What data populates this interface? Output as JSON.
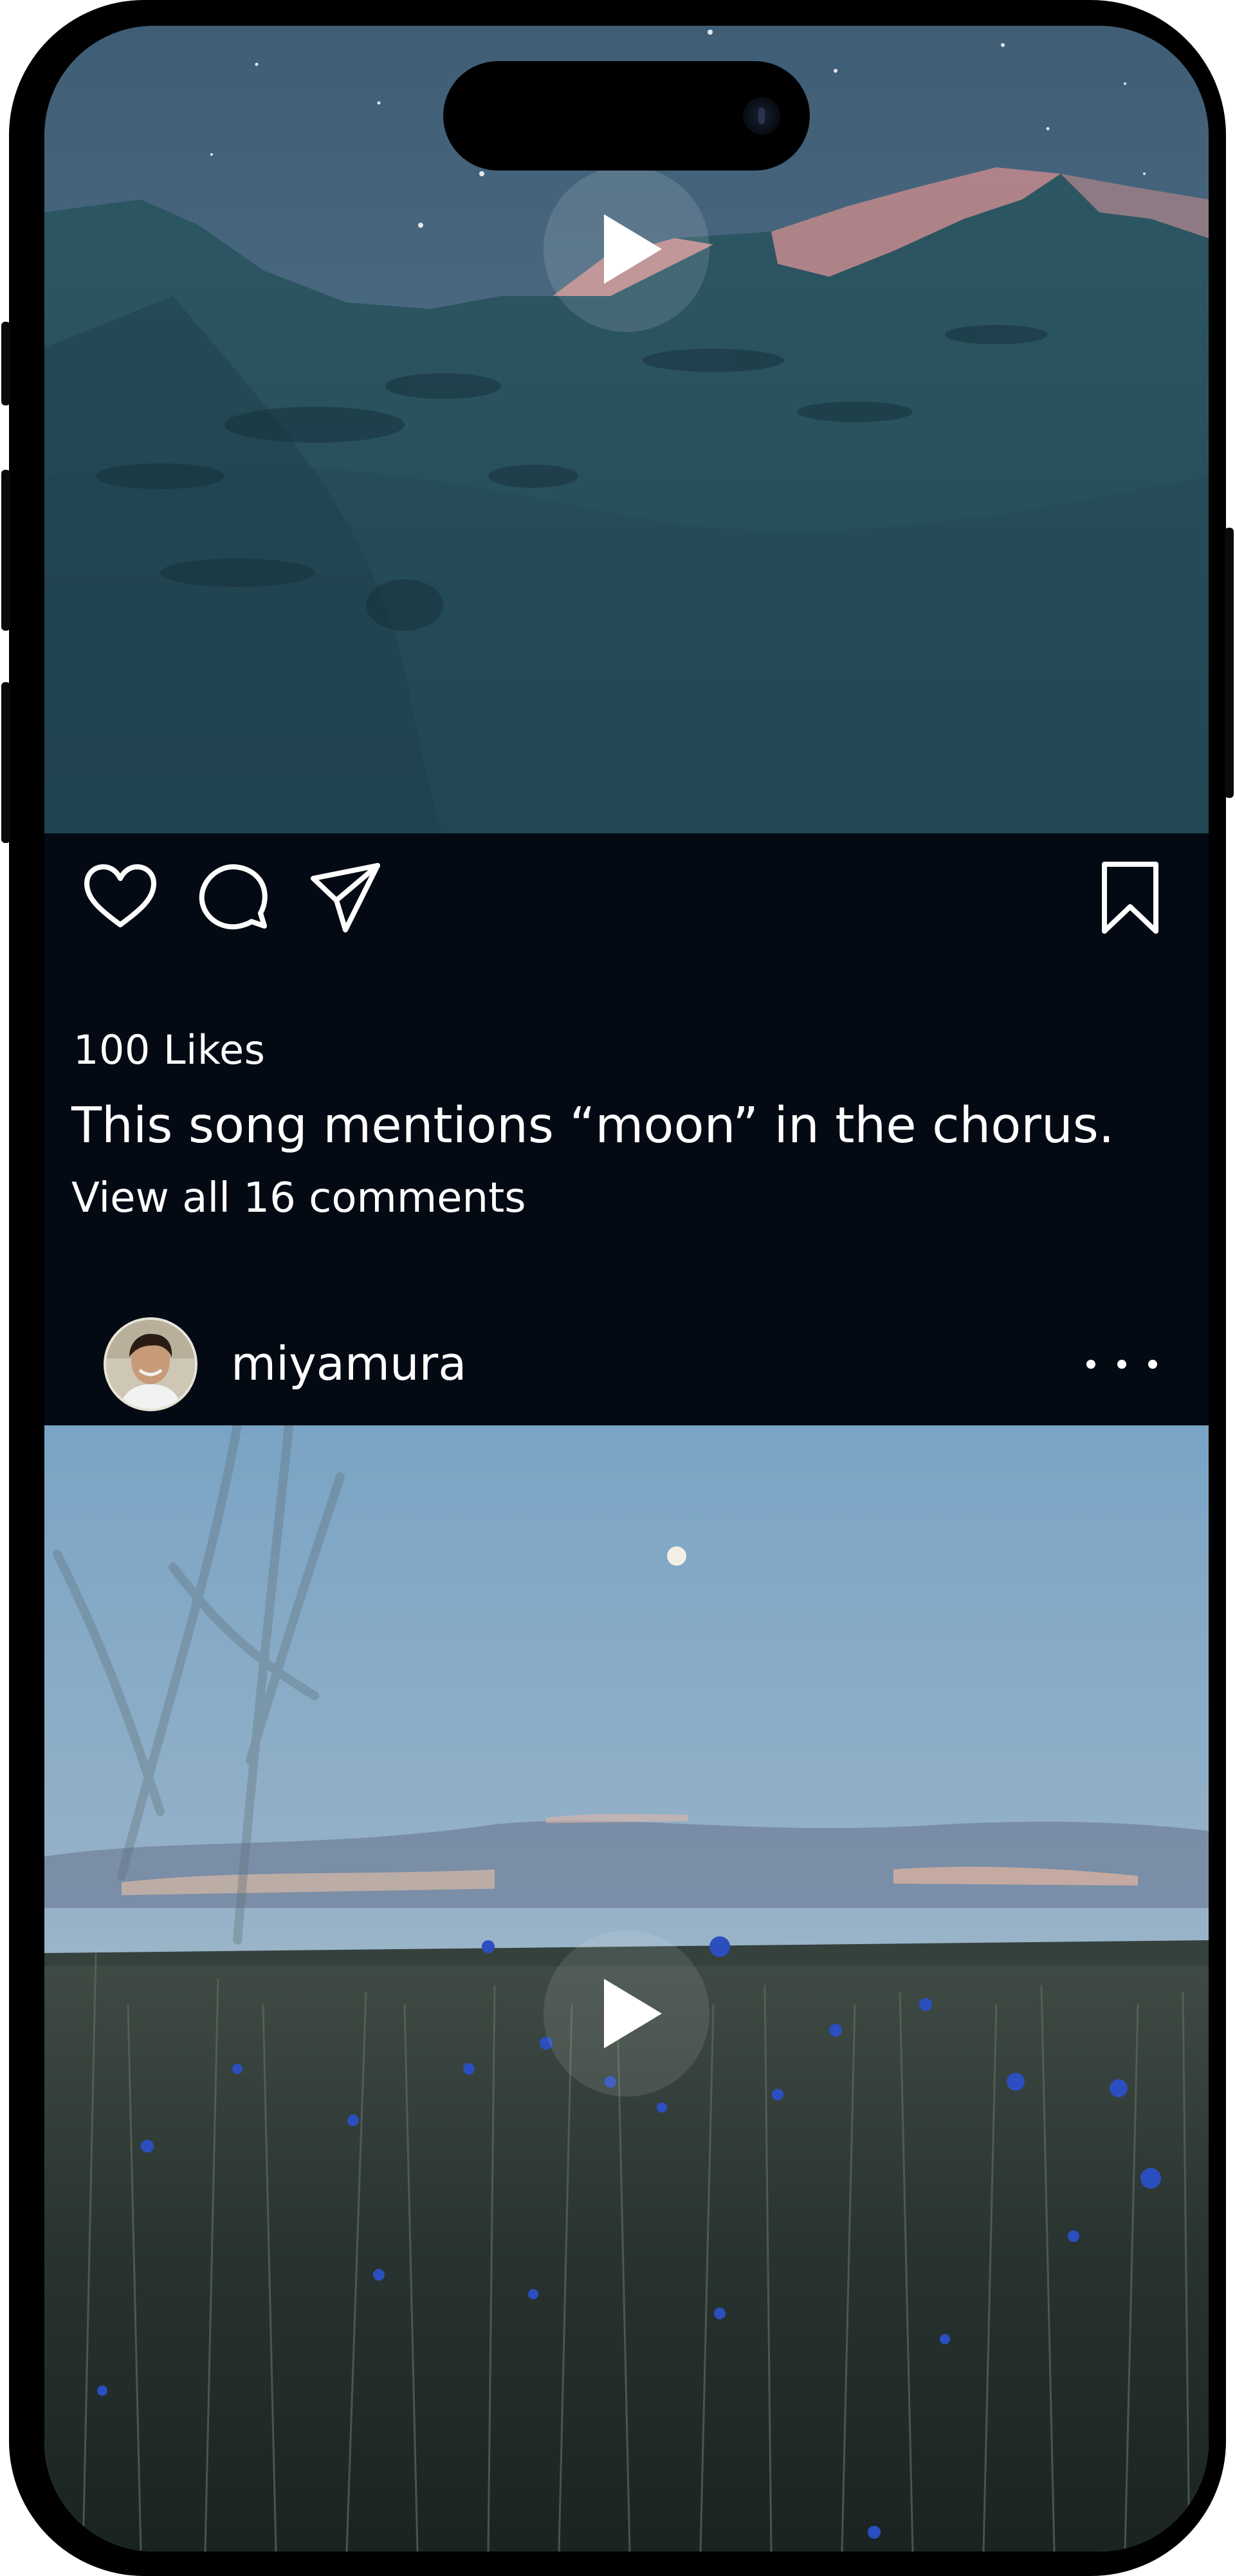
{
  "device": {
    "type": "phone"
  },
  "feed": {
    "post1": {
      "media": {
        "type": "video",
        "scene": "mountain-icon"
      },
      "actions": {
        "like_icon": "heart-icon",
        "comment_icon": "comment-icon",
        "share_icon": "send-icon",
        "save_icon": "bookmark-icon"
      },
      "likes": "100 Likes",
      "caption": "This song mentions “moon” in the chorus.",
      "view_comments": "View all 16 comments"
    },
    "post2": {
      "username": "miyamura",
      "more_icon": "more-dots-icon",
      "media": {
        "type": "video",
        "scene": "field-icon"
      }
    }
  },
  "colors": {
    "background": "#040a14",
    "text": "#ffffff"
  }
}
